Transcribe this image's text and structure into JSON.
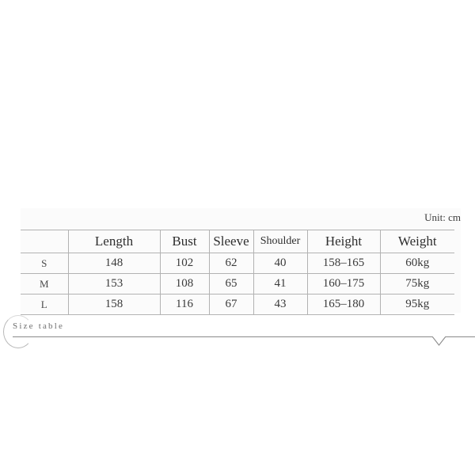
{
  "header": {
    "title": "Size table",
    "circle_icon": "circle-outline-icon",
    "chevron_icon": "chevron-down-icon",
    "line_color": "#8a8a8a"
  },
  "table": {
    "unit_note": "Unit: cm",
    "corner_label": "",
    "columns": [
      "Length",
      "Bust",
      "Sleeve",
      "Shoulder",
      "Height",
      "Weight"
    ],
    "rows": [
      {
        "size": "S",
        "length": "148",
        "bust": "102",
        "sleeve": "62",
        "shoulder": "40",
        "height": "158–165",
        "weight": "60kg"
      },
      {
        "size": "M",
        "length": "153",
        "bust": "108",
        "sleeve": "65",
        "shoulder": "41",
        "height": "160–175",
        "weight": "75kg"
      },
      {
        "size": "L",
        "length": "158",
        "bust": "116",
        "sleeve": "67",
        "shoulder": "43",
        "height": "165–180",
        "weight": "95kg"
      }
    ]
  }
}
